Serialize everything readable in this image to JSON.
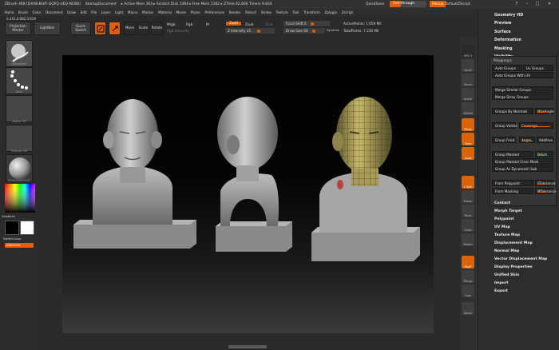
{
  "titlebar": {
    "title": "ZBrush 4R8 [DXVB-BLVF-QQFQ-UEQ-NCBB]",
    "document": "StartupDocument",
    "status": "▸ Active Mem 363 ▸ Scratch Disk 1464 ▸ Free Mem 1182 ▸ ZTime 42.600 Timers 9.824",
    "quicksave": "QuickSave",
    "seethrough": "See-through",
    "seethrough_value": 0,
    "menus": "Menus",
    "defaultzscript": "DefaultZScript"
  },
  "menubar": [
    "Alpha",
    "Brush",
    "Color",
    "Document",
    "Draw",
    "Edit",
    "File",
    "Layer",
    "Light",
    "Macro",
    "Marker",
    "Material",
    "Movie",
    "Picker",
    "Preferences",
    "Render",
    "Stencil",
    "Stroke",
    "Texture",
    "Tool",
    "Transform",
    "Zplugin",
    "Zscript"
  ],
  "toolrow": {
    "mem": "0.241,0.082,0.619",
    "projection_master": "Projection Master",
    "lightbox": "LightBox",
    "quick_sketch": "Quick Sketch",
    "edit": "Edit",
    "draw": "Draw",
    "move": "Move",
    "scale": "Scale",
    "rotate": "Rotate",
    "mrgb": "Mrgb",
    "rgb": "Rgb",
    "m": "M",
    "zadd": "Zadd",
    "zsub": "Zsub",
    "zcut": "Zcut",
    "rgb_intensity": "Rgb Intensity",
    "z_intensity": "Z Intensity 25",
    "focal_shift": "Focal Shift 0",
    "draw_size": "Draw Size 64",
    "dynamic": "Dynamic",
    "active_points": "ActivePoints: 1.059 Mil",
    "total_points": "TotalPoints: 7.230 Mil"
  },
  "leftpanel": {
    "labels": [
      "Standard",
      "Dots",
      "Alpha Off",
      "Texture Off",
      "BasicMaterial2"
    ],
    "gradient": "Gradient",
    "switchcolor": "SwitchColor",
    "alternate": "Alternate"
  },
  "righttools": [
    "SPix 3",
    "Scroll",
    "Zoom",
    "Actual",
    "AAHalf",
    "Persp",
    "Floor",
    "Local",
    "L.Sym",
    "Frame",
    "Move",
    "Scale",
    "Rotate",
    "PolyF",
    "Transp",
    "Solo",
    "Xpose"
  ],
  "rightpanel": {
    "top_headers": [
      "Geometry HD",
      "Preview",
      "Surface",
      "Deformation",
      "Masking",
      "Visibility"
    ],
    "polygroups": {
      "title": "Polygroups",
      "auto_groups": "Auto Groups",
      "uv_groups": "Uv Groups",
      "auto_groups_with_uv": "Auto Groups With UV",
      "merge_similar": "Merge Similar Groups",
      "merge_stray": "Merge Stray Groups",
      "groups_by_normals": "Groups By Normals",
      "max_angle": "MaxAngle",
      "group_visible": "Group Visible",
      "coverage": "Coverage",
      "group_front": "Group Front",
      "angle": "Angle",
      "additive": "Additive",
      "group_masked": "Group Masked",
      "polish": "Polish",
      "group_masked_clear": "Group Masked Clear Mask",
      "group_as_dynamesh": "Group As Dynamesh Sub",
      "from_polypaint": "From Polypaint",
      "ptolerance": "PTolerance",
      "from_masking": "From Masking",
      "mtolerance": "MTolerance"
    },
    "bottom_headers": [
      "Contact",
      "Morph Target",
      "Polypaint",
      "UV Map",
      "Texture Map",
      "Displacement Map",
      "Normal Map",
      "Vector Displacement Map",
      "Display Properties",
      "Unified Skin",
      "Import",
      "Export"
    ]
  },
  "colors": {
    "accent": "#e85d00",
    "panel": "#2d2d2d",
    "mesh_clay": "#9a9a9a",
    "mesh_polypaint": "#b7a85a"
  },
  "canvas": {
    "icons": [
      "clay-bust-front-icon",
      "clay-bust-side-icon",
      "polypaint-bust-icon"
    ]
  }
}
